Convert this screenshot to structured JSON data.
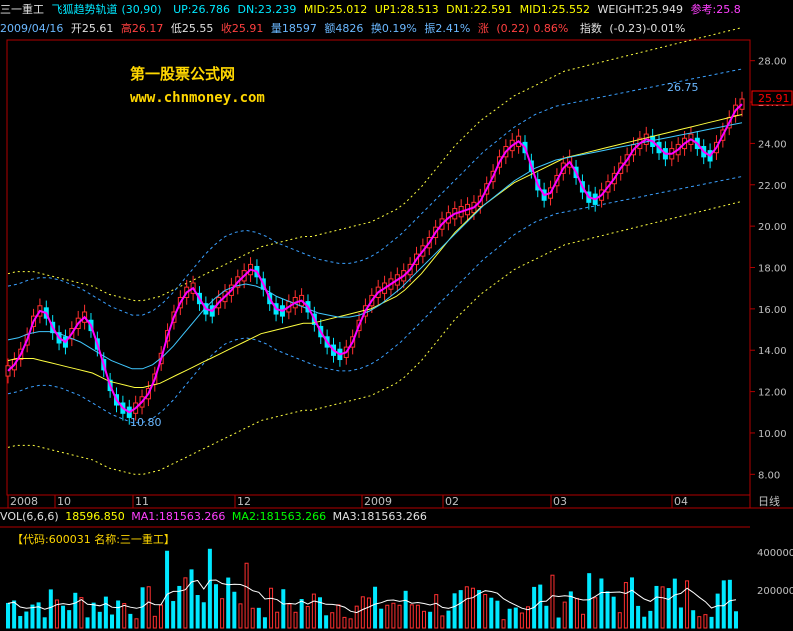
{
  "header": {
    "stock_name": "三一重工",
    "indicator_name": "飞狐趋势轨道",
    "indicator_params": "(30,90)",
    "up": "UP:26.786",
    "dn": "DN:23.239",
    "mid": "MID:25.012",
    "up1": "UP1:28.513",
    "dn1": "DN1:22.591",
    "mid1": "MID1:25.552",
    "weight": "WEIGHT:25.949",
    "ref": "参考:25.8"
  },
  "quote": {
    "date": "2009/04/16",
    "open": "开25.61",
    "high": "高26.17",
    "low": "低25.55",
    "close": "收25.91",
    "volume": "量18597",
    "amount": "额4826",
    "turnover": "换0.19%",
    "amplitude": "振2.41%",
    "change": "涨",
    "change_val": "(0.22)",
    "change_pct": "0.86%",
    "index": "指数",
    "index_val": "(-0.23)-0.01%"
  },
  "watermark": {
    "line1": "第一股票公式网",
    "line2": "www.chnmoney.com"
  },
  "period": "日线",
  "volume_header": {
    "vol": "VOL(6,6,6)",
    "vol_val": "18596.850",
    "ma1": "MA1:181563.266",
    "ma2": "MA2:181563.266",
    "ma3": "MA3:181563.266"
  },
  "code_box": "【代码:600031 名称:三一重工】",
  "colors": {
    "up_candle": "#ff3030",
    "down_candle": "#00e8ff",
    "main_line": "#ff00ff",
    "yellow_line": "#ffff40",
    "blue_line": "#3aa0ff",
    "cyan_line": "#40c8ff"
  },
  "chart_data": {
    "type": "line",
    "ylim": [
      7,
      29
    ],
    "y_ticks": [
      "28.00",
      "26.00",
      "24.00",
      "22.00",
      "20.00",
      "18.00",
      "16.00",
      "14.00",
      "12.00",
      "10.00",
      "8.00"
    ],
    "x_tick_labels": [
      "2008",
      "10",
      "11",
      "12",
      "2009",
      "02",
      "03",
      "04"
    ],
    "annotations": [
      "26.75",
      "10.80",
      "25.91"
    ],
    "last_price": 25.91,
    "main_line": [
      13.0,
      13.3,
      13.8,
      14.5,
      15.4,
      15.9,
      15.8,
      15.1,
      14.6,
      14.4,
      14.8,
      15.3,
      15.6,
      15.2,
      14.3,
      13.3,
      12.3,
      11.6,
      11.2,
      11.0,
      11.2,
      11.5,
      11.9,
      12.6,
      13.6,
      14.7,
      15.6,
      16.3,
      16.8,
      17.0,
      16.5,
      16.0,
      15.9,
      16.3,
      16.6,
      16.9,
      17.3,
      17.6,
      17.9,
      17.8,
      17.2,
      16.5,
      16.0,
      15.9,
      16.1,
      16.3,
      16.4,
      16.1,
      15.5,
      14.9,
      14.4,
      14.0,
      13.8,
      13.9,
      14.4,
      15.2,
      15.9,
      16.4,
      16.8,
      17.0,
      17.2,
      17.4,
      17.6,
      17.9,
      18.4,
      18.8,
      19.2,
      19.7,
      20.1,
      20.4,
      20.6,
      20.7,
      20.8,
      20.9,
      21.2,
      21.8,
      22.4,
      23.1,
      23.6,
      23.9,
      24.1,
      23.8,
      22.9,
      22.0,
      21.5,
      21.6,
      22.2,
      22.8,
      23.1,
      22.6,
      21.9,
      21.4,
      21.3,
      21.5,
      21.9,
      22.3,
      22.8,
      23.2,
      23.7,
      24.0,
      24.2,
      24.1,
      23.8,
      23.5,
      23.5,
      23.7,
      24.0,
      24.2,
      24.0,
      23.6,
      23.4,
      23.8,
      24.4,
      25.0,
      25.6,
      25.9
    ],
    "yellow_mid": [
      13.5,
      13.6,
      13.6,
      13.6,
      13.5,
      13.4,
      13.3,
      13.2,
      13.1,
      13.0,
      12.9,
      12.7,
      12.5,
      12.4,
      12.3,
      12.2,
      12.2,
      12.3,
      12.4,
      12.6,
      12.8,
      13.0,
      13.2,
      13.4,
      13.6,
      13.8,
      14.0,
      14.2,
      14.4,
      14.6,
      14.8,
      14.9,
      15.0,
      15.1,
      15.2,
      15.3,
      15.3,
      15.4,
      15.5,
      15.6,
      15.7,
      15.8,
      15.9,
      16.0,
      16.2,
      16.4,
      16.6,
      16.9,
      17.3,
      17.7,
      18.2,
      18.7,
      19.2,
      19.7,
      20.1,
      20.5,
      20.9,
      21.2,
      21.5,
      21.8,
      22.1,
      22.3,
      22.5,
      22.7,
      22.9,
      23.1,
      23.3,
      23.4,
      23.5,
      23.6,
      23.7,
      23.8,
      23.9,
      24.0,
      24.1,
      24.2,
      24.3,
      24.4,
      24.5,
      24.6,
      24.7,
      24.8,
      24.9,
      25.0,
      25.1,
      25.2,
      25.3,
      25.4
    ],
    "blue_mid": [
      14.5,
      14.6,
      14.8,
      14.9,
      14.9,
      14.8,
      14.6,
      14.4,
      14.1,
      13.8,
      13.5,
      13.3,
      13.1,
      13.1,
      13.3,
      13.7,
      14.2,
      14.8,
      15.4,
      16.0,
      16.5,
      16.9,
      17.1,
      17.2,
      17.1,
      16.9,
      16.6,
      16.4,
      16.2,
      16.0,
      15.8,
      15.7,
      15.6,
      15.6,
      15.7,
      15.9,
      16.2,
      16.6,
      17.0,
      17.5,
      18.0,
      18.5,
      19.0,
      19.5,
      20.0,
      20.5,
      21.0,
      21.4,
      21.8,
      22.2,
      22.5,
      22.8,
      23.0,
      23.2,
      23.3,
      23.4,
      23.5,
      23.6,
      23.7,
      23.8,
      23.9,
      24.0,
      24.1,
      24.2,
      24.3,
      24.4,
      24.5,
      24.6,
      24.7,
      24.8,
      24.9,
      25.0
    ]
  }
}
